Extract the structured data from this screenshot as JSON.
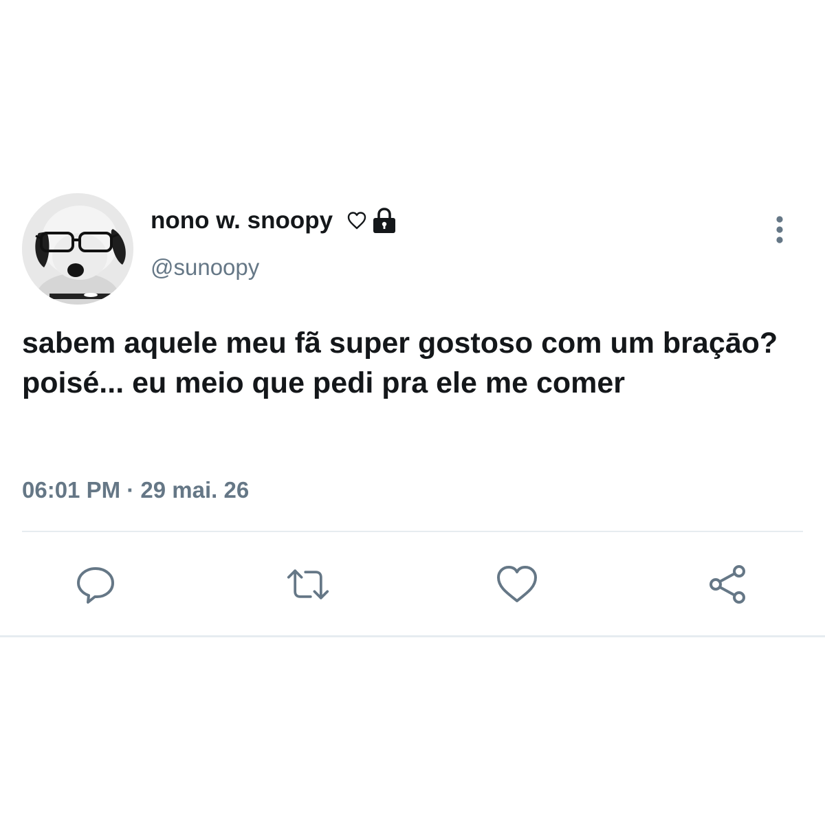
{
  "tweet": {
    "display_name": "nono w. snoopy",
    "handle": "@sunoopy",
    "name_icons": [
      "heart-outline-icon",
      "lock-icon"
    ],
    "text": "sabem aquele meu fã super gostoso com um braçāo? poisé... eu meio que pedi pra ele me comer",
    "time": "06:01 PM",
    "separator": "·",
    "date": "29 mai. 26"
  },
  "actions": [
    {
      "icon": "reply-icon"
    },
    {
      "icon": "retweet-icon"
    },
    {
      "icon": "like-icon"
    },
    {
      "icon": "share-icon"
    }
  ],
  "colors": {
    "text_primary": "#14171a",
    "text_secondary": "#657786",
    "icon": "#657786",
    "divider": "#e6ecf0",
    "background": "#ffffff"
  }
}
